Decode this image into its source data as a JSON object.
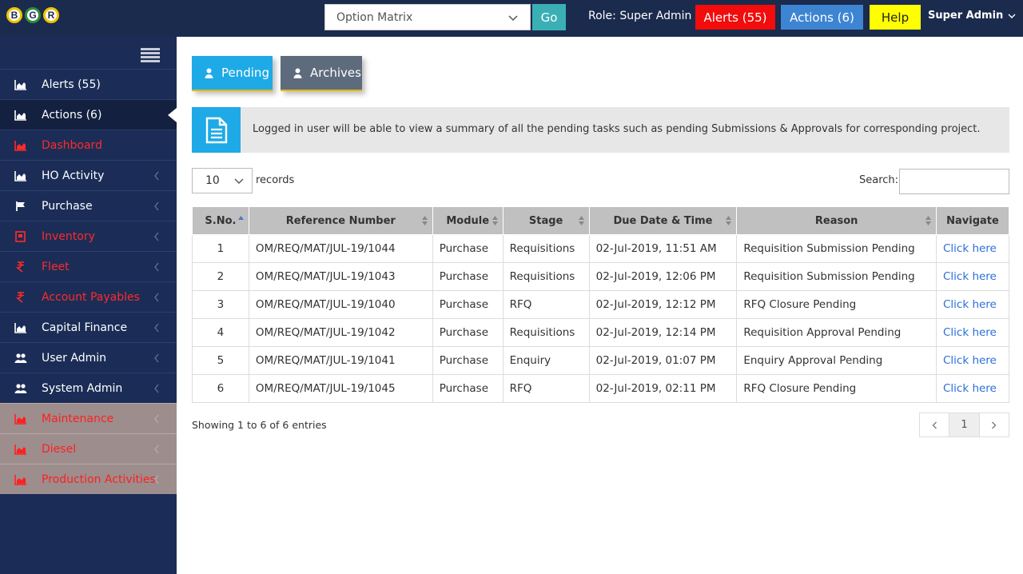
{
  "topbar": {
    "logo_letters": [
      "B",
      "G",
      "R"
    ],
    "project_select": "Option Matrix",
    "go_label": "Go",
    "role": "Role: Super Admin",
    "alerts": "Alerts (55)",
    "actions": "Actions (6)",
    "help": "Help",
    "user": "Super Admin",
    "colors": {
      "alerts": "#f20c0c",
      "actions": "#3d85d2",
      "help": "#ffff00"
    }
  },
  "sidebar": {
    "items": [
      {
        "label": "Alerts (55)",
        "icon": "area-chart-icon"
      },
      {
        "label": "Actions (6)",
        "icon": "area-chart-icon"
      },
      {
        "label": "Dashboard",
        "icon": "area-chart-icon"
      },
      {
        "label": "HO Activity",
        "icon": "area-chart-icon"
      },
      {
        "label": "Purchase",
        "icon": "flag-icon"
      },
      {
        "label": "Inventory",
        "icon": "inventory-icon"
      },
      {
        "label": "Fleet",
        "icon": "rupee-icon"
      },
      {
        "label": "Account Payables",
        "icon": "rupee-icon"
      },
      {
        "label": "Capital Finance",
        "icon": "area-chart-icon"
      },
      {
        "label": "User Admin",
        "icon": "users-icon"
      },
      {
        "label": "System Admin",
        "icon": "users-icon"
      },
      {
        "label": "Maintenance",
        "icon": "area-chart-icon"
      },
      {
        "label": "Diesel",
        "icon": "area-chart-icon"
      },
      {
        "label": "Production Activities",
        "icon": "area-chart-icon"
      }
    ]
  },
  "tabs": {
    "pending": "Pending",
    "archives": "Archives"
  },
  "info": "Logged in user will be able to view a summary of all the pending tasks such as pending Submissions & Approvals for corresponding project.",
  "table_controls": {
    "length": "10",
    "length_label": "records",
    "search_label": "Search:"
  },
  "table": {
    "headers": [
      "S.No.",
      "Reference Number",
      "Module",
      "Stage",
      "Due Date & Time",
      "Reason",
      "Navigate"
    ],
    "rows": [
      [
        "1",
        "OM/REQ/MAT/JUL-19/1044",
        "Purchase",
        "Requisitions",
        "02-Jul-2019, 11:51 AM",
        "Requisition Submission Pending",
        "Click here"
      ],
      [
        "2",
        "OM/REQ/MAT/JUL-19/1043",
        "Purchase",
        "Requisitions",
        "02-Jul-2019, 12:06 PM",
        "Requisition Submission Pending",
        "Click here"
      ],
      [
        "3",
        "OM/REQ/MAT/JUL-19/1040",
        "Purchase",
        "RFQ",
        "02-Jul-2019, 12:12 PM",
        "RFQ Closure Pending",
        "Click here"
      ],
      [
        "4",
        "OM/REQ/MAT/JUL-19/1042",
        "Purchase",
        "Requisitions",
        "02-Jul-2019, 12:14 PM",
        "Requisition Approval Pending",
        "Click here"
      ],
      [
        "5",
        "OM/REQ/MAT/JUL-19/1041",
        "Purchase",
        "Enquiry",
        "02-Jul-2019, 01:07 PM",
        "Enquiry Approval Pending",
        "Click here"
      ],
      [
        "6",
        "OM/REQ/MAT/JUL-19/1045",
        "Purchase",
        "RFQ",
        "02-Jul-2019, 02:11 PM",
        "RFQ Closure Pending",
        "Click here"
      ]
    ]
  },
  "footer": {
    "summary": "Showing 1 to 6 of 6 entries",
    "current_page": "1"
  }
}
